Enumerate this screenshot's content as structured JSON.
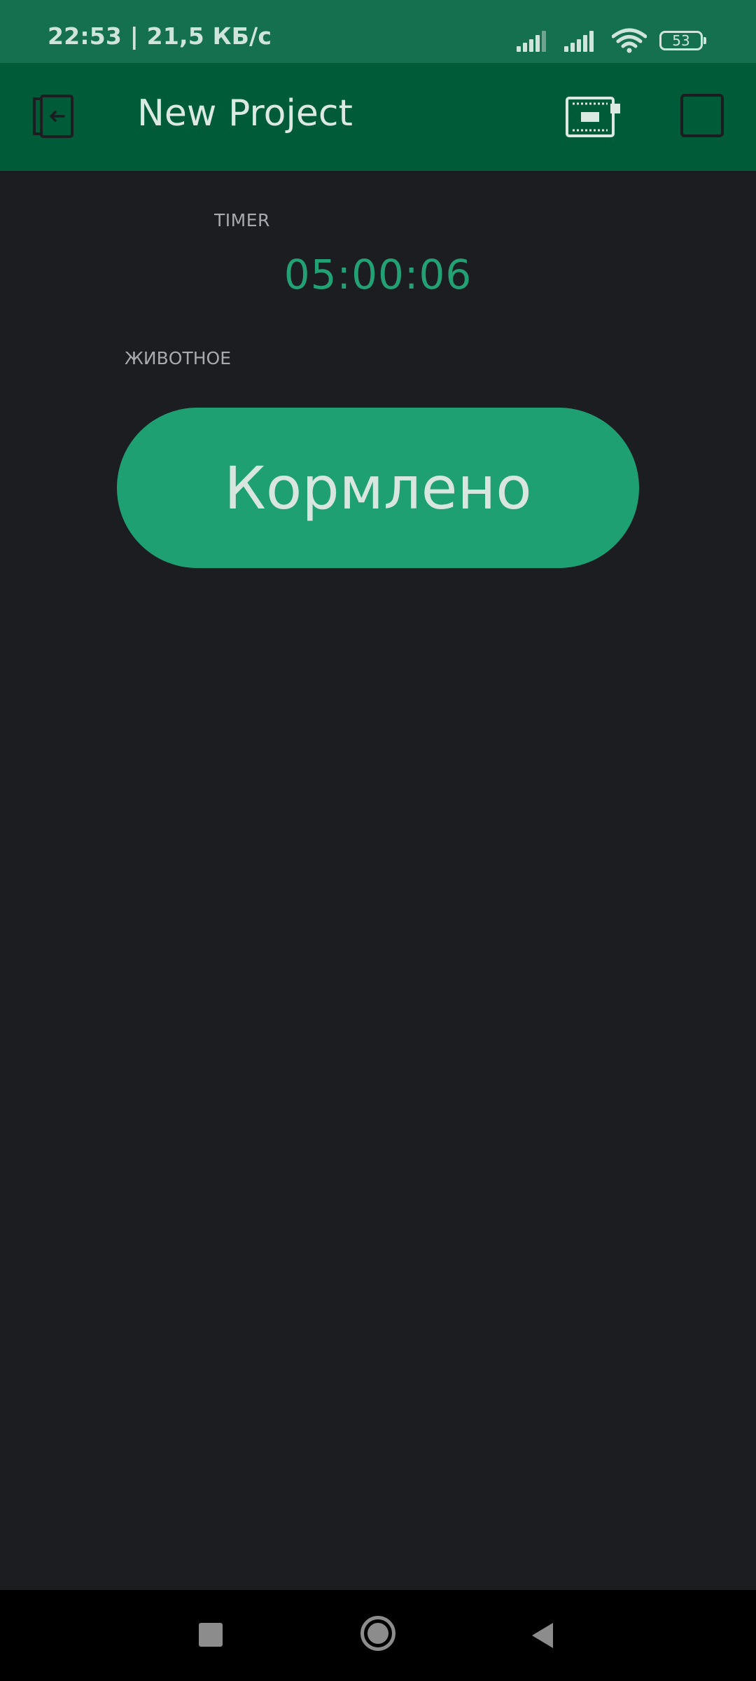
{
  "status_bar": {
    "time_and_speed": "22:53 | 21,5 КБ/с",
    "battery_level": "53",
    "icons": [
      "signal-icon",
      "signal-icon",
      "wifi-icon",
      "battery-icon"
    ]
  },
  "app_bar": {
    "title": "New Project",
    "icons": [
      "exit-project-icon",
      "device-icon",
      "play-icon"
    ]
  },
  "timer_widget": {
    "label": "TIMER",
    "value": "05:00:06"
  },
  "button_widget": {
    "label": "ЖИВОТНОЕ",
    "text": "Кормлено"
  },
  "nav_bar": {
    "icons": [
      "recents-icon",
      "home-icon",
      "back-icon"
    ]
  },
  "colors": {
    "status_bar": "#15704f",
    "app_bar": "#005c38",
    "background": "#1c1d21",
    "accent": "#1ea073",
    "timer_text": "#23a074"
  }
}
